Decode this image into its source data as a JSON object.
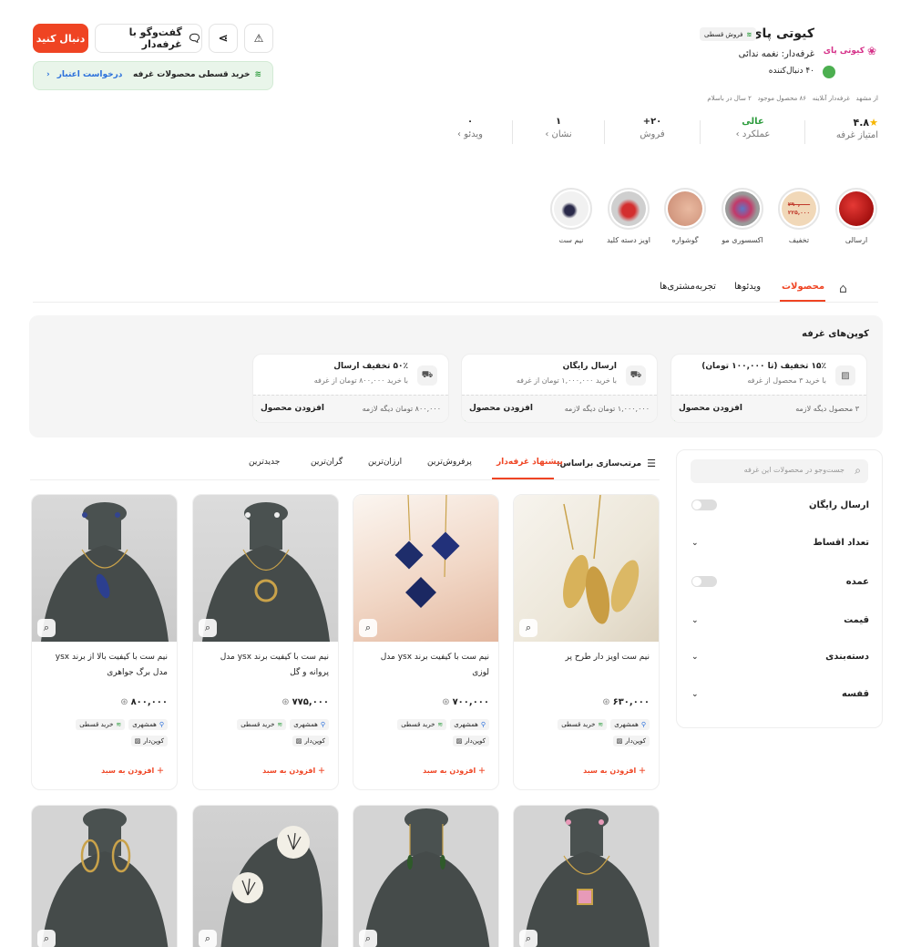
{
  "colors": {
    "accent": "#ef4423",
    "green": "#2e9c3e",
    "star": "#f6b500"
  },
  "header": {
    "shop_name": "کیوتی پای",
    "logo_text": "کیوتی پای",
    "installment_badge": "فروش قسطی",
    "owner": "غرفه‌دار: نغمه ندائی",
    "followers": "۴۰ دنبال‌کننده",
    "meta": "از مشهد   غرفه‌دار آنلاینه   ۸۶ محصول موجود   ۲ سال در باسلام",
    "follow_label": "دنبال کنید",
    "chat_label": "گفت‌وگو با غرفه‌دار",
    "installment_banner": "خرید قسطی محصولات غرفه",
    "credit_request": "درخواست اعتبار"
  },
  "stats": [
    {
      "value": "۴.۸",
      "label": "امتیاز غرفه"
    },
    {
      "value": "عالی",
      "label": "عملکرد"
    },
    {
      "value": "۲۰+",
      "label": "فروش"
    },
    {
      "value": "۱",
      "label": "نشان"
    },
    {
      "value": "۰",
      "label": "ویدئو"
    }
  ],
  "stories": [
    {
      "label": "ارسالی"
    },
    {
      "label": "تخفیف"
    },
    {
      "label": "اکسسوری مو"
    },
    {
      "label": "گوشواره"
    },
    {
      "label": "اویز دسته کلید"
    },
    {
      "label": "نیم ست"
    }
  ],
  "story_overlay": {
    "line1": "۲۹۰,۰۰۰",
    "line2": "۲۲۵,۰۰۰"
  },
  "tabs": [
    {
      "label": "محصولات"
    },
    {
      "label": "ویدئوها"
    },
    {
      "label": "تجربه‌مشتری‌ها"
    }
  ],
  "coupons": {
    "title": "کوپن‌های غرفه",
    "items": [
      {
        "title": "۱۵٪ تخفیف (تا ۱۰۰,۰۰۰ تومان)",
        "sub": "با خرید ۳ محصول از غرفه",
        "need": "۳ محصول دیگه لازمه",
        "add": "افزودن محصول"
      },
      {
        "title": "ارسال رایگان",
        "sub": "با خرید ۱,۰۰۰,۰۰۰ تومان از غرفه",
        "need": "۱,۰۰۰,۰۰۰ تومان دیگه لازمه",
        "add": "افزودن محصول"
      },
      {
        "title": "۵۰٪ تخفیف ارسال",
        "sub": "با خرید ۸۰۰,۰۰۰ تومان از غرفه",
        "need": "۸۰۰,۰۰۰ تومان دیگه لازمه",
        "add": "افزودن محصول"
      }
    ]
  },
  "sort": {
    "label": "مرتب‌سازی براساس:",
    "options": [
      {
        "label": "پیشنهاد غرفه‌دار"
      },
      {
        "label": "پرفروش‌ترین"
      },
      {
        "label": "ارزان‌ترین"
      },
      {
        "label": "گران‌ترین"
      },
      {
        "label": "جدیدترین"
      }
    ]
  },
  "filters": {
    "search_placeholder": "جست‌وجو در محصولات این غرفه",
    "items": [
      {
        "label": "ارسال رایگان"
      },
      {
        "label": "تعداد اقساط"
      },
      {
        "label": "عمده"
      },
      {
        "label": "قیمت"
      },
      {
        "label": "دسته‌بندی"
      },
      {
        "label": "قفسه"
      }
    ]
  },
  "products": [
    {
      "name": "نیم ست اویز دار طرح پر",
      "price": "۶۳۰,۰۰۰"
    },
    {
      "name": "نیم ست با کیفیت برند ysx مدل لوزی",
      "price": "۷۰۰,۰۰۰"
    },
    {
      "name": "نیم ست با کیفیت برند ysx مدل پروانه و گل",
      "price": "۷۷۵,۰۰۰"
    },
    {
      "name": "نیم ست با کیفیت بالا از برند ysx مدل برگ جواهری",
      "price": "۸۰۰,۰۰۰"
    }
  ],
  "product_tags": {
    "neighbor": "همشهری",
    "installment": "خرید قسطی",
    "coupon": "کوپن‌دار",
    "add_to_cart": "افزودن به سبد"
  }
}
